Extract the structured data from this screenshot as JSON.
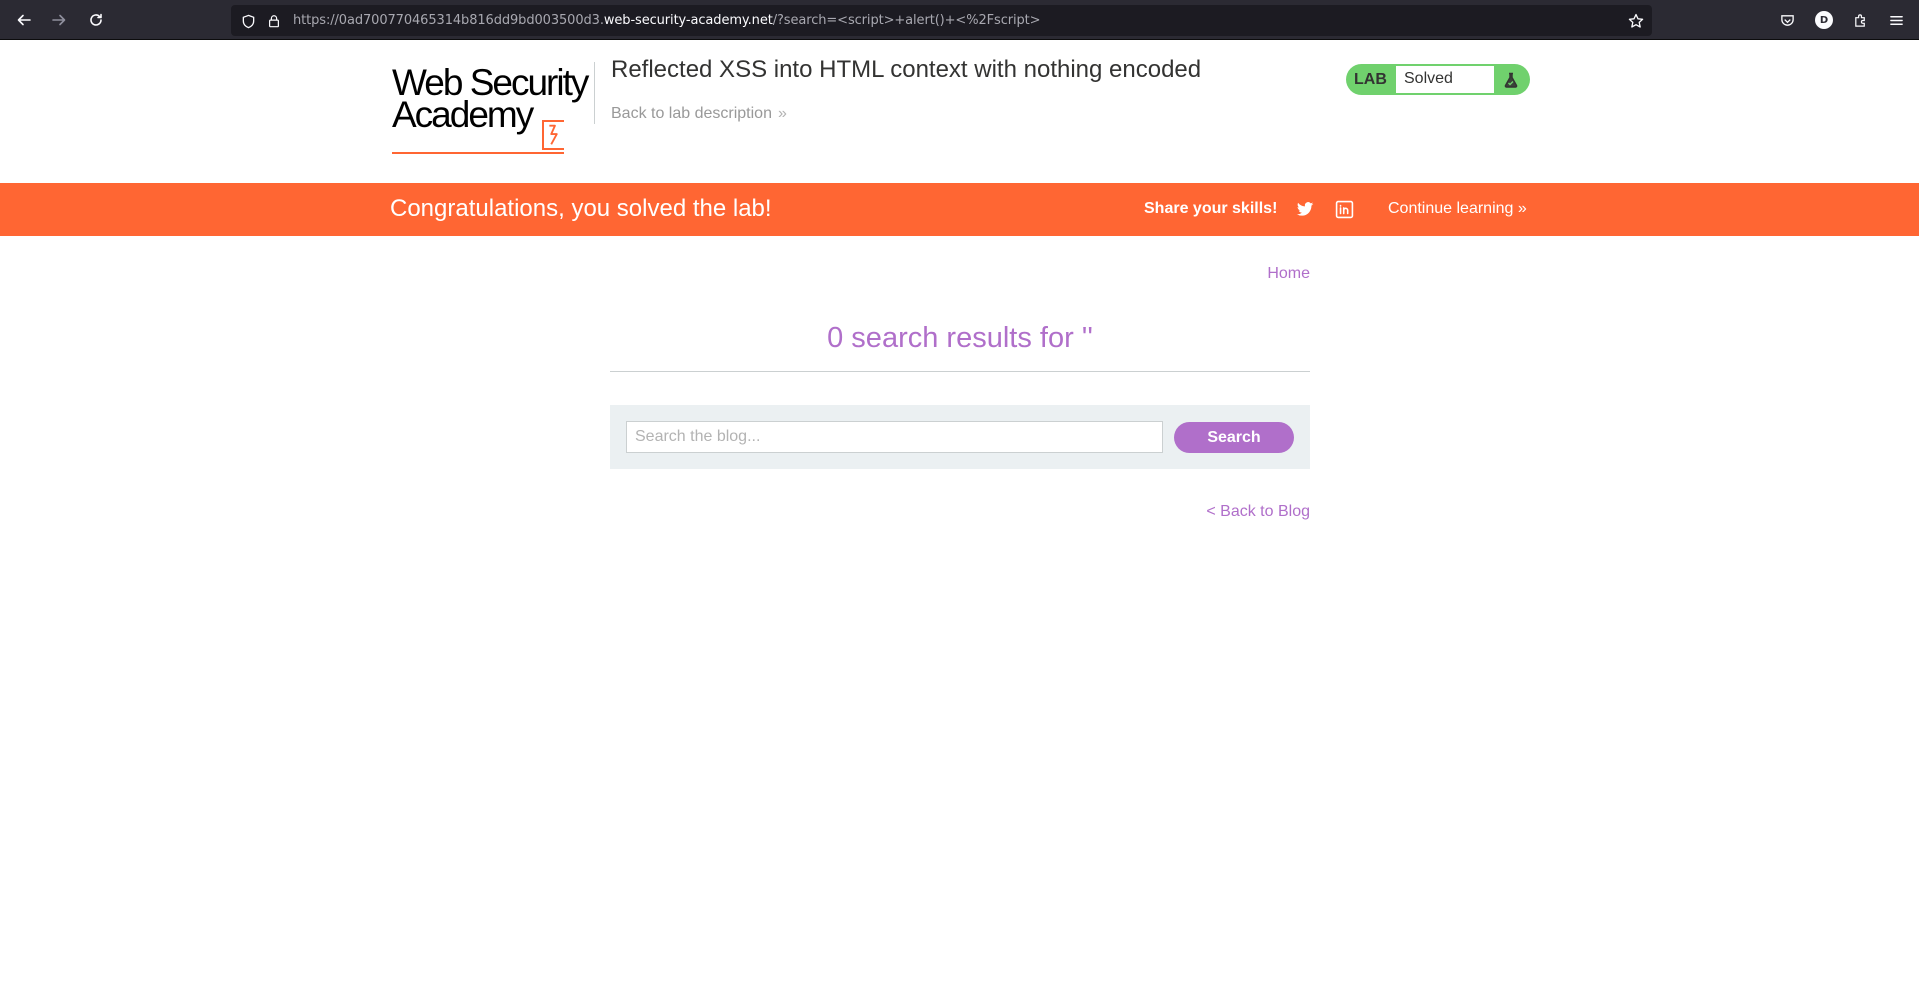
{
  "browser": {
    "url_prefix": "https://0ad700770465314b816dd9bd003500d3.",
    "url_host": "web-security-academy.net",
    "url_suffix": "/?search=<script>+alert()+<%2Fscript>",
    "avatar_letter": "D",
    "icons": [
      "back-arrow-icon",
      "forward-arrow-icon",
      "reload-icon",
      "shield-icon",
      "lock-icon",
      "star-icon",
      "pocket-icon",
      "account-icon",
      "extensions-icon",
      "menu-icon"
    ]
  },
  "header": {
    "logo_line1": "Web Security",
    "logo_line2": "Academy",
    "title": "Reflected XSS into HTML context with nothing encoded",
    "back_link": "Back to lab description",
    "back_chevron": "»",
    "status_label": "LAB",
    "status_value": "Solved",
    "status_icon": "flask-icon"
  },
  "banner": {
    "message": "Congratulations, you solved the lab!",
    "share_label": "Share your skills!",
    "share_icons": [
      "twitter-icon",
      "linkedin-icon"
    ],
    "continue_label": "Continue learning",
    "continue_chevron": "»"
  },
  "content": {
    "home_link": "Home",
    "results_heading": "0 search results for ''",
    "search_placeholder": "Search the blog...",
    "search_button": "Search",
    "back_to_blog": "< Back to Blog"
  },
  "colors": {
    "accent_orange": "#ff6633",
    "accent_purple": "#b06fca",
    "solved_green": "#70d16d",
    "chrome_dark": "#2b2a33"
  }
}
